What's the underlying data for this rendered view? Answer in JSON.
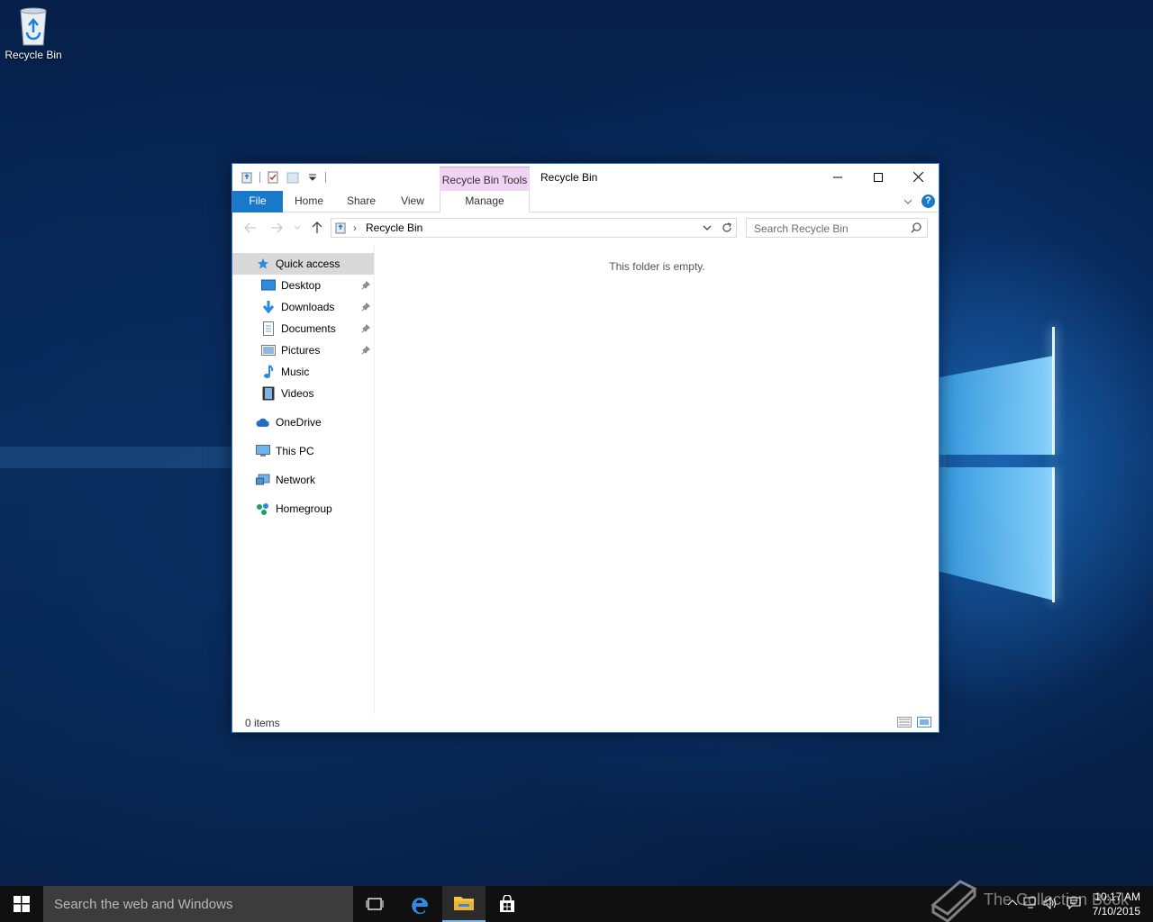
{
  "desktop": {
    "icon_label": "Recycle Bin"
  },
  "window": {
    "title": "Recycle Bin",
    "contextual_tab_group": "Recycle Bin Tools",
    "ribbon": {
      "tabs": [
        "File",
        "Home",
        "Share",
        "View",
        "Manage"
      ]
    },
    "address": {
      "crumb": "Recycle Bin",
      "separator": "›"
    },
    "search": {
      "placeholder": "Search Recycle Bin"
    },
    "nav": {
      "quick_access": "Quick access",
      "items": [
        {
          "label": "Desktop",
          "pinned": true
        },
        {
          "label": "Downloads",
          "pinned": true
        },
        {
          "label": "Documents",
          "pinned": true
        },
        {
          "label": "Pictures",
          "pinned": true
        },
        {
          "label": "Music",
          "pinned": false
        },
        {
          "label": "Videos",
          "pinned": false
        }
      ],
      "onedrive": "OneDrive",
      "this_pc": "This PC",
      "network": "Network",
      "homegroup": "Homegroup"
    },
    "content": {
      "empty_message": "This folder is empty."
    },
    "status": {
      "count": "0 items"
    }
  },
  "taskbar": {
    "search_placeholder": "Search the web and Windows",
    "time": "10:17 AM",
    "date": "7/10/2015",
    "watermark": "The Collection Book"
  },
  "colors": {
    "file_tab": "#1979ca",
    "contextual": "#f0d4f3",
    "taskbar": "#101010",
    "selection": "#d9d9d9"
  }
}
